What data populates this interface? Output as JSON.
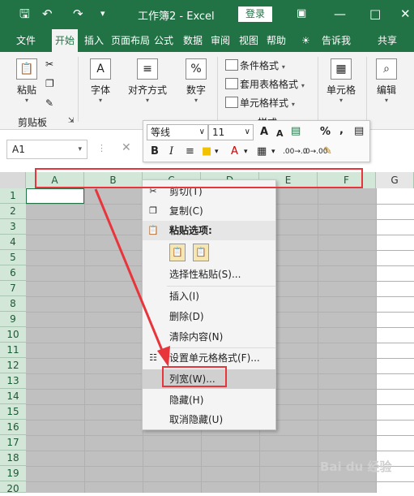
{
  "titlebar": {
    "save_icon": "save-icon",
    "undo_icon": "undo-icon",
    "redo_icon": "redo-icon",
    "title": "工作簿2 - Excel",
    "login_label": "登录",
    "window_buttons": [
      "restore-icon",
      "minimize-icon",
      "maximize-icon",
      "close-icon"
    ]
  },
  "tabs": [
    "文件",
    "开始",
    "插入",
    "页面布局",
    "公式",
    "数据",
    "审阅",
    "视图",
    "帮助",
    "告诉我",
    "共享"
  ],
  "ribbon": {
    "paste_label": "粘贴",
    "clipboard_group": "剪贴板",
    "font_label": "字体",
    "align_label": "对齐方式",
    "number_label": "数字",
    "conditional_format": "条件格式",
    "table_format": "套用表格格式",
    "cell_style": "单元格样式",
    "style_group": "样式",
    "cells_label": "单元格",
    "edit_label": "编辑"
  },
  "formula": {
    "cell_ref": "A1",
    "fx_icon": "cancel-icon"
  },
  "minibar": {
    "font_name": "等线",
    "font_size": "11",
    "bold": "B",
    "italic": "I",
    "grow_font": "A",
    "shrink_font": "A",
    "percent": "%",
    "comma": ",",
    "decimal_increase": ".00→.0",
    "decimal_decrease": ".0→.00"
  },
  "columns": [
    "A",
    "B",
    "C",
    "D",
    "E",
    "F",
    "G"
  ],
  "rows": [
    "1",
    "2",
    "3",
    "4",
    "5",
    "6",
    "7",
    "8",
    "9",
    "10",
    "11",
    "12",
    "13",
    "14",
    "15",
    "16",
    "17",
    "18",
    "19",
    "20"
  ],
  "context_menu": {
    "cut": "剪切(T)",
    "copy": "复制(C)",
    "paste_options": "粘贴选项:",
    "paste_special": "选择性粘贴(S)...",
    "insert": "插入(I)",
    "delete": "删除(D)",
    "clear": "清除内容(N)",
    "format_cells": "设置单元格格式(F)...",
    "column_width": "列宽(W)...",
    "hide": "隐藏(H)",
    "unhide": "取消隐藏(U)"
  },
  "watermark": "Bai du 经验",
  "colors": {
    "excel_green": "#217346",
    "header_highlight": "#d2e7d8",
    "annotation_red": "#e8353b"
  }
}
